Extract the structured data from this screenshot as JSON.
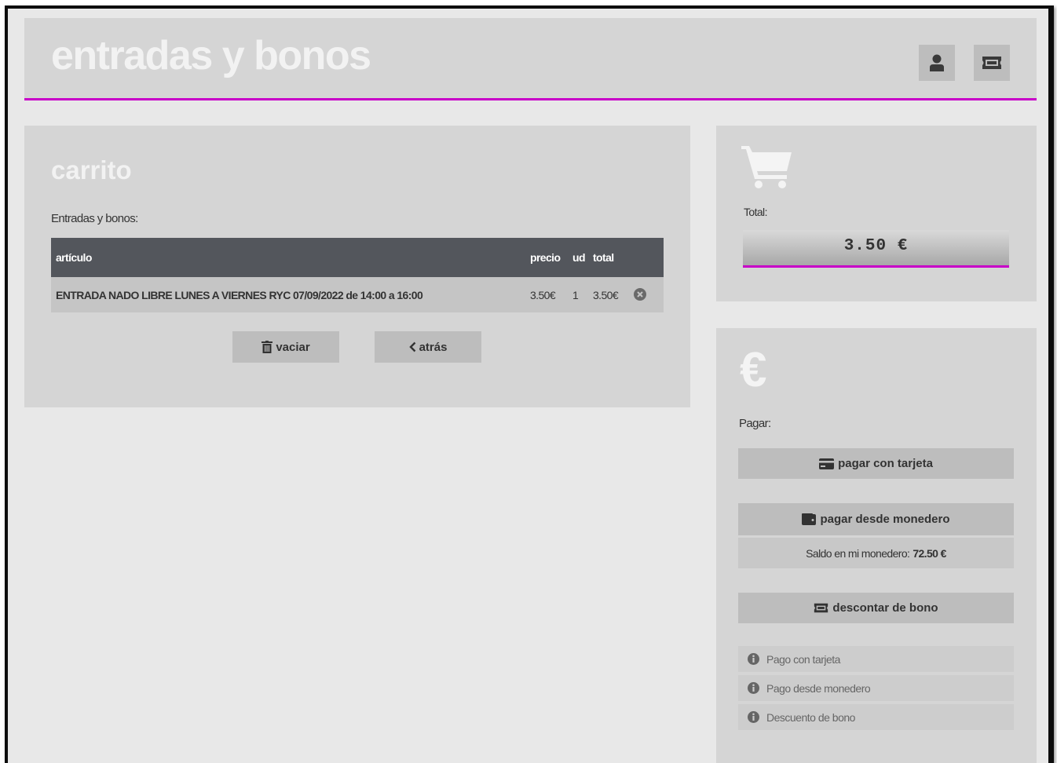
{
  "header": {
    "title": "entradas y bonos",
    "user_icon": "user-icon",
    "ticket_icon": "ticket-icon",
    "accent_color": "#c800c8"
  },
  "cart": {
    "title": "carrito",
    "subtitle": "Entradas y bonos:",
    "columns": [
      "artículo",
      "precio",
      "ud",
      "total"
    ],
    "rows": [
      {
        "articulo": "ENTRADA NADO LIBRE LUNES A VIERNES RYC 07/09/2022 de 14:00 a 16:00",
        "precio": "3.50€",
        "ud": "1",
        "total": "3.50€",
        "remove_icon": "remove-circle-icon"
      }
    ],
    "vaciar_label": "vaciar",
    "atras_label": "atrás"
  },
  "summary": {
    "cart_icon": "shopping-cart-icon",
    "total_label": "Total:",
    "total_value": "3.50 €"
  },
  "payment": {
    "euro_icon": "€",
    "label": "Pagar:",
    "card_button": "pagar con tarjeta",
    "wallet_button": "pagar desde monedero",
    "saldo_text": "Saldo en mi monedero:",
    "saldo_value": "72.50 €",
    "bono_button": "descontar de bono",
    "info_items": [
      "Pago con tarjeta",
      "Pago desde monedero",
      "Descuento de bono"
    ]
  }
}
